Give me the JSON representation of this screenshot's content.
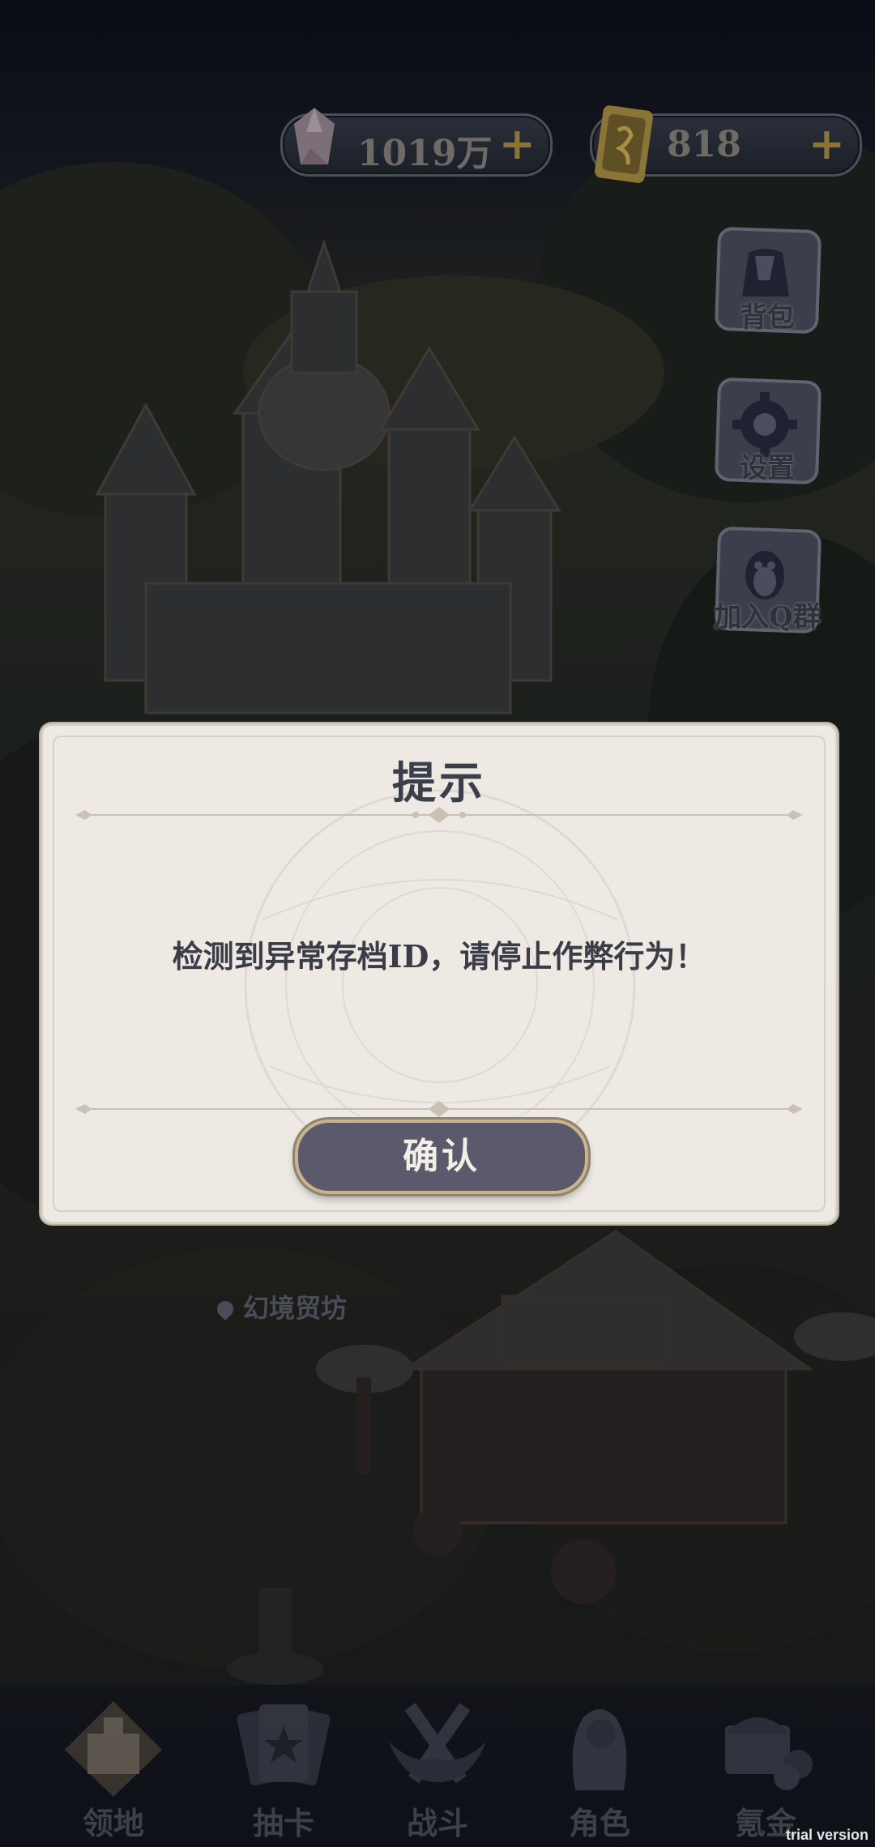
{
  "currencies": [
    {
      "icon": "crystal-icon",
      "value": "1019万",
      "plus": "+"
    },
    {
      "icon": "ticket-icon",
      "value": "818",
      "plus": "+"
    }
  ],
  "side_buttons": [
    {
      "icon": "backpack-icon",
      "label": "背包"
    },
    {
      "icon": "gear-icon",
      "label": "设置"
    },
    {
      "icon": "qq-penguin-icon",
      "label": "加入Q群"
    }
  ],
  "location": {
    "icon": "location-pin-icon",
    "label": "幻境贸坊"
  },
  "dialog": {
    "title": "提示",
    "message": "检测到异常存档ID，请停止作弊行为！",
    "confirm_label": "确认"
  },
  "bottom_nav": [
    {
      "icon": "castle-icon",
      "label": "领地"
    },
    {
      "icon": "card-icon",
      "label": "抽卡"
    },
    {
      "icon": "crossed-swords-icon",
      "label": "战斗"
    },
    {
      "icon": "character-icon",
      "label": "角色"
    },
    {
      "icon": "treasure-chest-icon",
      "label": "氪金"
    }
  ],
  "watermark": "trial version",
  "colors": {
    "dialog_bg": "#eeeae3",
    "button_bg": "#5a5a6c",
    "button_border": "#c9b58c",
    "title_text": "#3b3f4c"
  }
}
